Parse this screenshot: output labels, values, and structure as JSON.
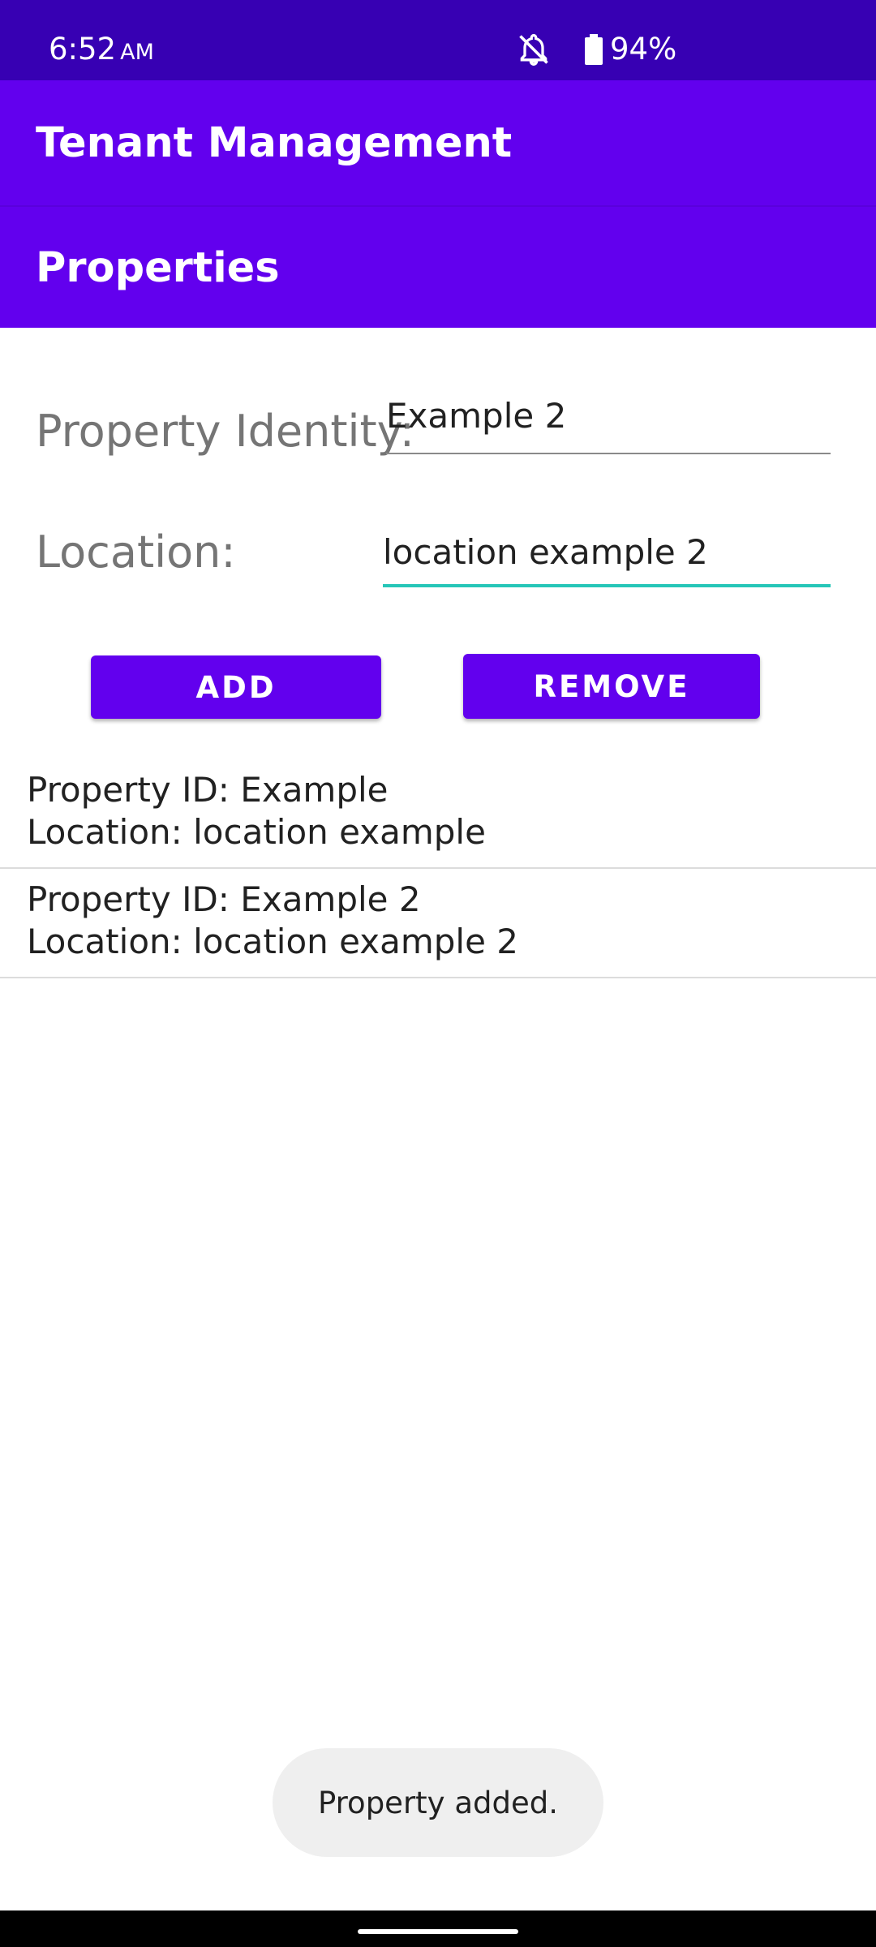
{
  "status_bar": {
    "time": "6:52",
    "ampm": "AM",
    "battery": "94%",
    "icons": [
      "notifications-off-icon",
      "battery-icon"
    ]
  },
  "app_bar": {
    "title": "Tenant Management"
  },
  "section": {
    "title": "Properties"
  },
  "form": {
    "property_identity_label": "Property Identity:",
    "property_identity_value": "Example 2",
    "location_label": "Location:",
    "location_value": "location example 2"
  },
  "buttons": {
    "add": "ADD",
    "remove": "REMOVE"
  },
  "properties": [
    {
      "id_line": "Property ID: Example",
      "location_line": "Location: location example"
    },
    {
      "id_line": "Property ID: Example 2",
      "location_line": "Location: location example 2"
    }
  ],
  "toast": {
    "message": "Property added."
  },
  "colors": {
    "status_bar": "#3700b3",
    "primary": "#6200ee",
    "focus_underline": "#26c6b8"
  }
}
